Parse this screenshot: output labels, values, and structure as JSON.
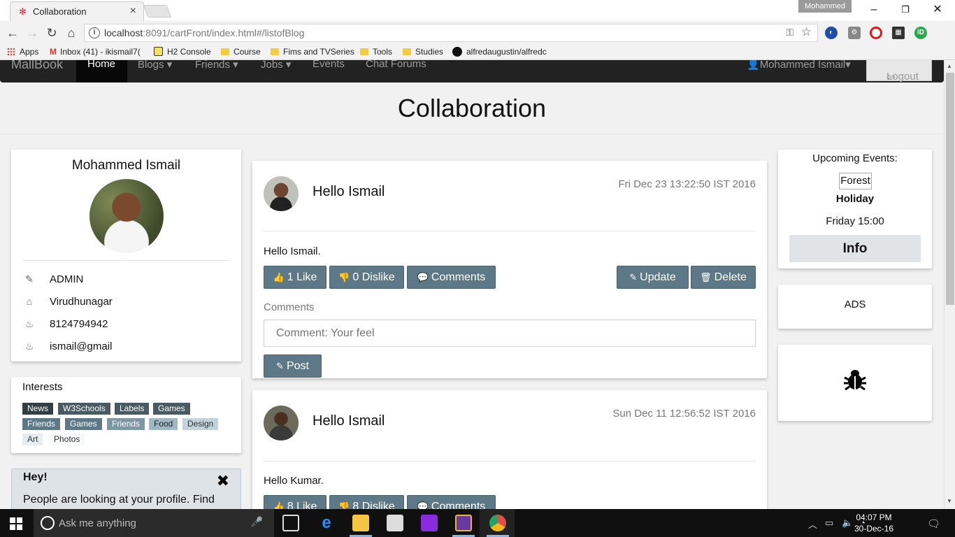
{
  "browser": {
    "tab_title": "Collaboration",
    "profile_name": "Mohammed",
    "url_host": "localhost",
    "url_rest": ":8091/cartFront/index.html#/listofBlog",
    "bookmarks": [
      {
        "label": "Apps",
        "icon": "apps-icon"
      },
      {
        "label": "Inbox (41) - ikismail7(",
        "icon": "gmail-icon"
      },
      {
        "label": "H2 Console",
        "icon": "h2-icon"
      },
      {
        "label": "Course",
        "icon": "folder-icon"
      },
      {
        "label": "Fims and TVSeries",
        "icon": "folder-icon"
      },
      {
        "label": "Tools",
        "icon": "folder-icon"
      },
      {
        "label": "Studies",
        "icon": "folder-icon"
      },
      {
        "label": "alfredaugustin/alfredc",
        "icon": "github-icon"
      }
    ]
  },
  "navbar": {
    "brand": "MallBook",
    "home": "Home",
    "items": [
      "Blogs ▾",
      "Friends ▾",
      "Jobs ▾",
      "Events",
      "Chat Forums"
    ],
    "user": "Mohammed Ismail▾",
    "logout": "Logout"
  },
  "page_title": "Collaboration",
  "profile": {
    "name": "Mohammed Ismail",
    "rows": [
      {
        "icon": "pencil-icon",
        "text": "ADMIN"
      },
      {
        "icon": "home-icon",
        "text": "Virudhunagar"
      },
      {
        "icon": "birthday-cake-icon",
        "text": "8124794942"
      },
      {
        "icon": "birthday-cake-icon",
        "text": "ismail@gmail"
      }
    ]
  },
  "interests": {
    "title": "Interests",
    "tags": [
      "News",
      "W3Schools",
      "Labels",
      "Games",
      "Friends",
      "Games",
      "Friends",
      "Food",
      "Design",
      "Art",
      "Photos"
    ]
  },
  "hey": {
    "title": "Hey!",
    "text": "People are looking at your profile. Find"
  },
  "posts": [
    {
      "title": "Hello Ismail",
      "date": "Fri Dec 23 13:22:50 IST 2016",
      "body": "Hello Ismail.",
      "like": "1 Like",
      "dislike": "0 Dislike",
      "comments": "Comments",
      "update": "Update",
      "delete": "Delete",
      "comments_label": "Comments",
      "comment_placeholder": "Comment: Your feel",
      "post_button": "Post"
    },
    {
      "title": "Hello Ismail",
      "date": "Sun Dec 11 12:56:52 IST 2016",
      "body": "Hello Kumar.",
      "like": "8 Like",
      "dislike": "8 Dislike",
      "comments": "Comments"
    }
  ],
  "events": {
    "title": "Upcoming Events:",
    "box": "Forest",
    "name": "Holiday",
    "time": "Friday 15:00",
    "info": "Info"
  },
  "ads": {
    "label": "ADS"
  },
  "taskbar": {
    "search_placeholder": "Ask me anything",
    "time": "04:07 PM",
    "date": "30-Dec-16"
  },
  "colors": {
    "button": "#5d7886",
    "navbar": "#222222",
    "page_bg": "#f1f1f1"
  }
}
